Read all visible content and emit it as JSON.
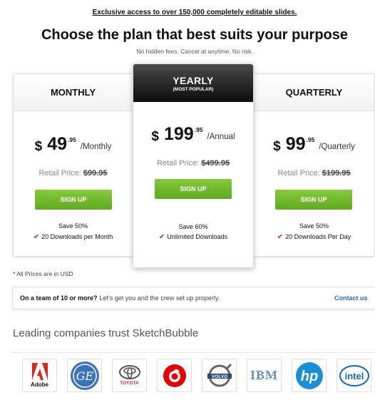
{
  "header": {
    "top_link": "Exclusive access to over 150,000 completely editable slides.",
    "headline": "Choose the plan that best suits your purpose",
    "subline": "No hidden fees. Cancel at anytime. No risk."
  },
  "plans": {
    "monthly": {
      "title": "MONTHLY",
      "currency": "$",
      "amount": "49",
      "cents": ".95",
      "period": "/Monthly",
      "retail_label": "Retail Price:",
      "retail_price": "$99.95",
      "button": "SIGN UP",
      "save": "Save 50%",
      "feature": "20 Downloads per Month"
    },
    "yearly": {
      "title": "YEARLY",
      "badge": "(MOST POPULAR)",
      "currency": "$",
      "amount": "199",
      "cents": ".95",
      "period": "/Annual",
      "retail_label": "Retail Price:",
      "retail_price": "$499.95",
      "button": "SIGN UP",
      "save": "Save 60%",
      "feature": "Unlimited Downloads"
    },
    "quarterly": {
      "title": "QUARTERLY",
      "currency": "$",
      "amount": "99",
      "cents": ".95",
      "period": "/Quarterly",
      "retail_label": "Retail Price:",
      "retail_price": "$199.95",
      "button": "SIGN UP",
      "save": "Save 50%",
      "feature": "20 Downloads Per Day"
    }
  },
  "footnote": "* All Prices are in USD",
  "team": {
    "bold": "On a team of 10 or more?",
    "text": "Let's get you and the crew set up properly.",
    "link": "Contact us"
  },
  "trust_heading": "Leading companies trust SketchBubble",
  "logos": {
    "adobe": "Adobe",
    "ge": "GE",
    "toyota": "TOYOTA",
    "vodafone": "",
    "volvo": "VOLVO",
    "ibm": "IBM",
    "hp": "hp",
    "intel": "intel"
  },
  "colors": {
    "signup_green": "#6cb52a",
    "check_red": "#d9262b",
    "link_blue": "#2a6fb6"
  },
  "icons": [
    "check-icon",
    "adobe-logo",
    "ge-logo",
    "toyota-logo",
    "vodafone-logo",
    "volvo-logo",
    "ibm-logo",
    "hp-logo",
    "intel-logo"
  ]
}
